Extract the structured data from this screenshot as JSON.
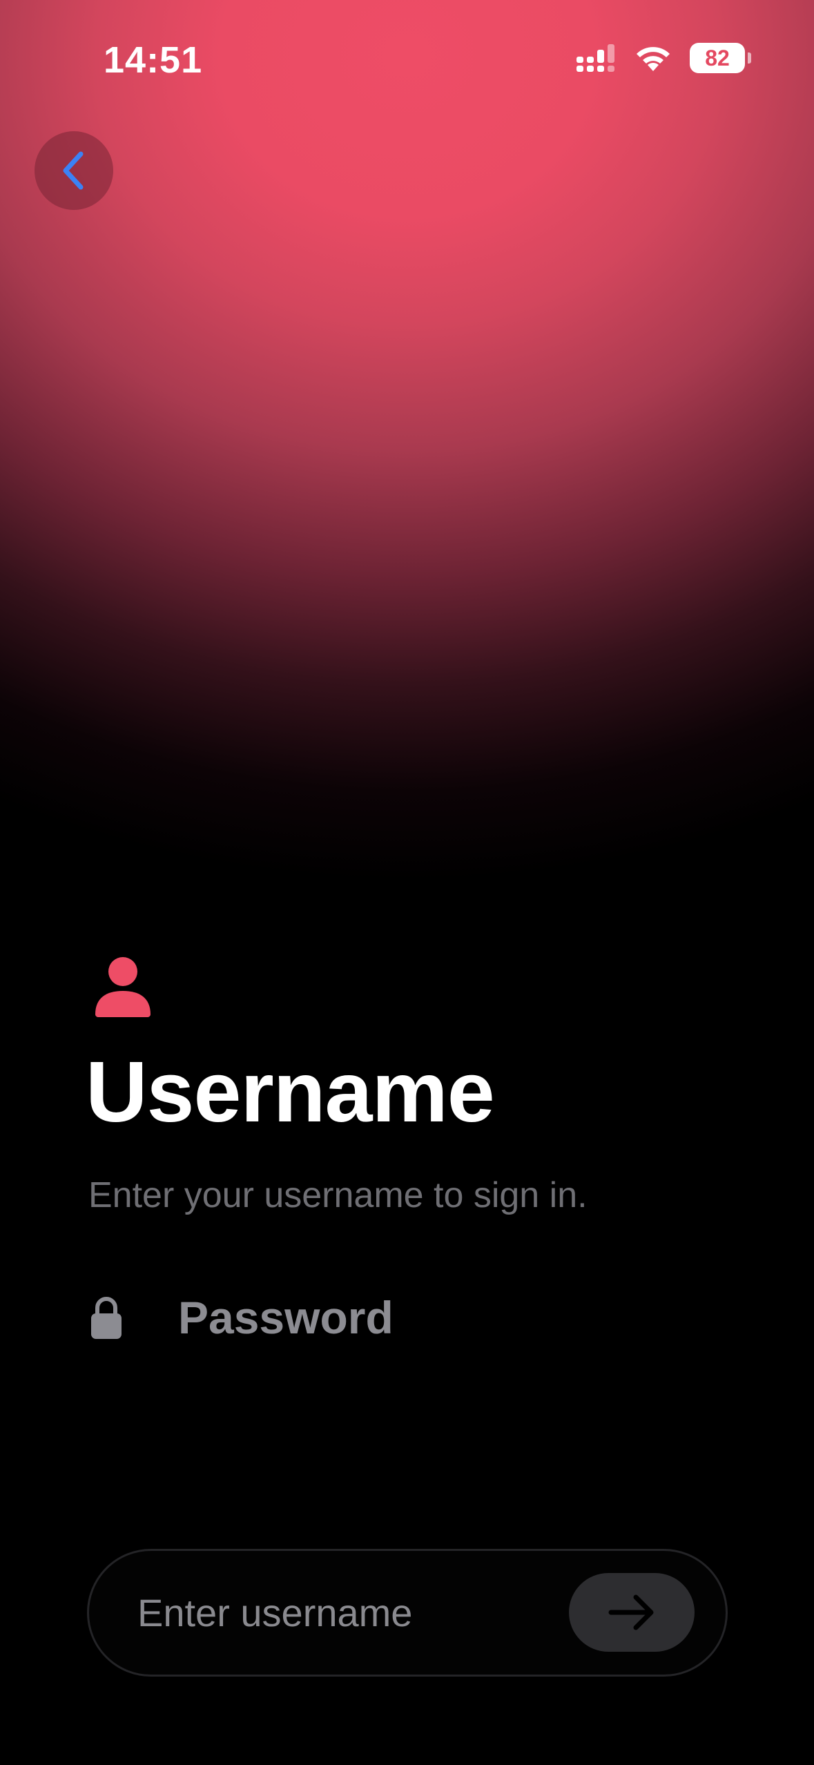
{
  "status_bar": {
    "time": "14:51",
    "battery": "82",
    "signal_icon": "cellular-signal-icon",
    "wifi_icon": "wifi-icon"
  },
  "nav": {
    "back_icon": "chevron-left-icon"
  },
  "header": {
    "icon": "person-icon",
    "title": "Username",
    "subtitle": "Enter your username to sign in."
  },
  "password_option": {
    "icon": "lock-icon",
    "label": "Password"
  },
  "username_form": {
    "placeholder": "Enter username",
    "value": "",
    "submit_icon": "arrow-right-icon"
  },
  "colors": {
    "accent": "#EE4D66",
    "back_chevron": "#3B82F6",
    "background": "#000000",
    "muted_text": "#6F6F74"
  }
}
